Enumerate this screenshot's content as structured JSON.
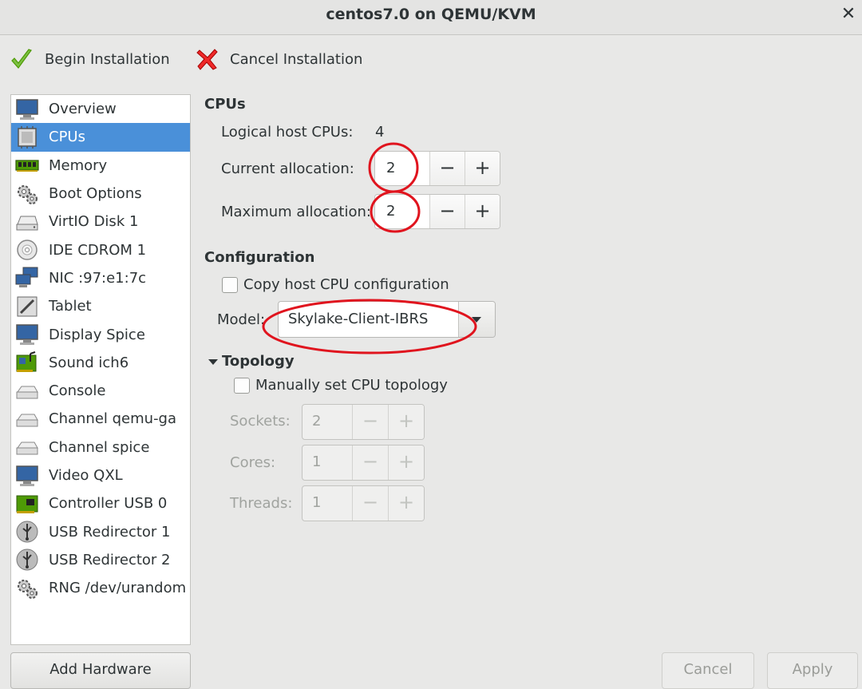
{
  "window": {
    "title": "centos7.0 on QEMU/KVM",
    "close_icon": "close-icon"
  },
  "toolbar": {
    "begin_label": "Begin Installation",
    "cancel_label": "Cancel Installation"
  },
  "sidebar": {
    "items": [
      {
        "label": "Overview",
        "icon": "monitor-icon"
      },
      {
        "label": "CPUs",
        "icon": "cpu-icon",
        "selected": true
      },
      {
        "label": "Memory",
        "icon": "memory-icon"
      },
      {
        "label": "Boot Options",
        "icon": "gears-icon"
      },
      {
        "label": "VirtIO Disk 1",
        "icon": "disk-icon"
      },
      {
        "label": "IDE CDROM 1",
        "icon": "cdrom-icon"
      },
      {
        "label": "NIC :97:e1:7c",
        "icon": "network-icon"
      },
      {
        "label": "Tablet",
        "icon": "tablet-icon"
      },
      {
        "label": "Display Spice",
        "icon": "monitor-icon"
      },
      {
        "label": "Sound ich6",
        "icon": "sound-card-icon"
      },
      {
        "label": "Console",
        "icon": "serial-icon"
      },
      {
        "label": "Channel qemu-ga",
        "icon": "serial-icon"
      },
      {
        "label": "Channel spice",
        "icon": "serial-icon"
      },
      {
        "label": "Video QXL",
        "icon": "monitor-icon"
      },
      {
        "label": "Controller USB 0",
        "icon": "controller-card-icon"
      },
      {
        "label": "USB Redirector 1",
        "icon": "usb-icon"
      },
      {
        "label": "USB Redirector 2",
        "icon": "usb-icon"
      },
      {
        "label": "RNG /dev/urandom",
        "icon": "gears-icon"
      }
    ],
    "add_hardware_label": "Add Hardware"
  },
  "cpus": {
    "heading": "CPUs",
    "logical_label": "Logical host CPUs:",
    "logical_value": "4",
    "current_label": "Current allocation:",
    "current_value": "2",
    "maximum_label": "Maximum allocation:",
    "maximum_value": "2",
    "minus": "−",
    "plus": "+"
  },
  "configuration": {
    "heading": "Configuration",
    "copy_host_label": "Copy host CPU configuration",
    "copy_host_checked": false,
    "model_label": "Model:",
    "model_value": "Skylake-Client-IBRS"
  },
  "topology": {
    "heading": "Topology",
    "manual_label": "Manually set CPU topology",
    "manual_checked": false,
    "sockets_label": "Sockets:",
    "sockets_value": "2",
    "cores_label": "Cores:",
    "cores_value": "1",
    "threads_label": "Threads:",
    "threads_value": "1"
  },
  "footer": {
    "cancel_label": "Cancel",
    "apply_label": "Apply"
  },
  "colors": {
    "selection": "#4a90d9",
    "annotation": "#e0141e"
  }
}
